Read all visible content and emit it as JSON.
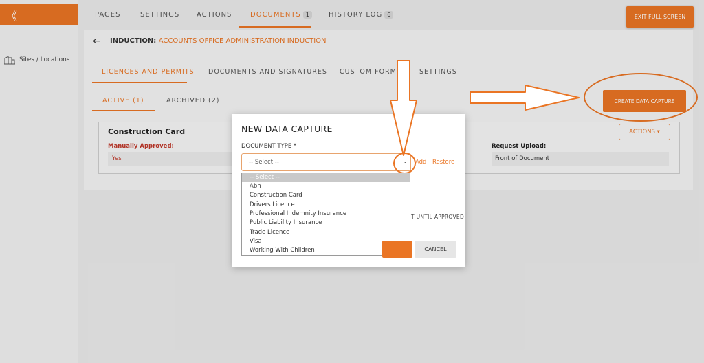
{
  "sidebar": {
    "collapse_glyph": "《",
    "items": [
      {
        "label": "Sites / Locations",
        "icon": "buildings-icon"
      }
    ]
  },
  "topnav": {
    "tabs": [
      {
        "label": "PAGES"
      },
      {
        "label": "SETTINGS"
      },
      {
        "label": "ACTIONS"
      },
      {
        "label": "DOCUMENTS",
        "badge": "1"
      },
      {
        "label": "HISTORY LOG",
        "badge": "6"
      }
    ],
    "exit_label": "EXIT FULL SCREEN"
  },
  "header": {
    "prefix": "INDUCTION:",
    "name": "ACCOUNTS OFFICE ADMINISTRATION INDUCTION"
  },
  "section_tabs": [
    "LICENCES AND PERMITS",
    "DOCUMENTS AND SIGNATURES",
    "CUSTOM FORMS",
    "SETTINGS"
  ],
  "status_tabs": [
    "ACTIVE (1)",
    "ARCHIVED (2)"
  ],
  "create_label": "CREATE DATA CAPTURE",
  "card": {
    "title": "Construction Card",
    "approved_label": "Manually Approved:",
    "approved_value": "Yes",
    "upload_label": "Request Upload:",
    "upload_value": "Front of Document",
    "actions_label": "ACTIONS ▾"
  },
  "modal": {
    "title": "NEW DATA CAPTURE",
    "doc_type_label": "DOCUMENT TYPE *",
    "select_value": "-- Select --",
    "add_label": "Add",
    "restore_label": "Restore",
    "options": [
      "-- Select --",
      "Abn",
      "Construction Card",
      "Drivers Licence",
      "Professional Indemnity Insurance",
      "Public Liability Insurance",
      "Trade Licence",
      "Visa",
      "Working With Children"
    ],
    "partial_text": "T UNTIL APPROVED",
    "cancel_label": "CANCEL"
  },
  "colors": {
    "accent": "#ea7524"
  }
}
